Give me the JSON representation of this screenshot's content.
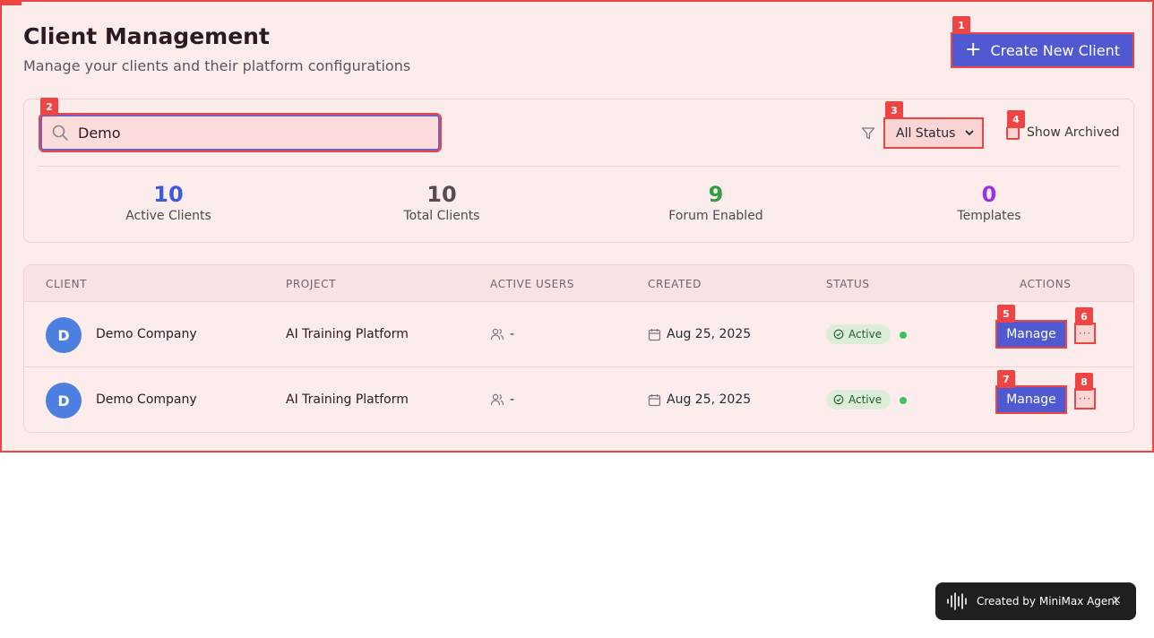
{
  "header": {
    "title": "Client Management",
    "subtitle": "Manage your clients and their platform configurations",
    "create_button_label": "Create New Client"
  },
  "markers": [
    "1",
    "2",
    "3",
    "4",
    "5",
    "6",
    "7",
    "8"
  ],
  "filters": {
    "search_value": "Demo",
    "status_selected": "All Status",
    "show_archived_label": "Show Archived"
  },
  "stats": [
    {
      "value": "10",
      "label": "Active Clients",
      "color": "#3b5bdb"
    },
    {
      "value": "10",
      "label": "Total Clients",
      "color": "#5a4a55"
    },
    {
      "value": "9",
      "label": "Forum Enabled",
      "color": "#2f9e44"
    },
    {
      "value": "0",
      "label": "Templates",
      "color": "#9333ea"
    }
  ],
  "table": {
    "columns": [
      "CLIENT",
      "PROJECT",
      "ACTIVE USERS",
      "CREATED",
      "STATUS",
      "ACTIONS"
    ],
    "rows": [
      {
        "initial": "D",
        "client": "Demo Company",
        "project": "AI Training Platform",
        "users": "-",
        "created": "Aug 25, 2025",
        "status": "Active",
        "action": "Manage",
        "more": "···"
      },
      {
        "initial": "D",
        "client": "Demo Company",
        "project": "AI Training Platform",
        "users": "-",
        "created": "Aug 25, 2025",
        "status": "Active",
        "action": "Manage",
        "more": "···"
      }
    ]
  },
  "toast": {
    "text": "Created by MiniMax Agent",
    "close": "×"
  }
}
